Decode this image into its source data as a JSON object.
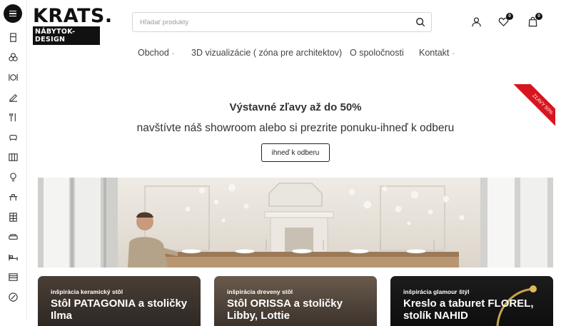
{
  "brand": {
    "name": "KRATS.",
    "tagline": "NÁBYTOK-DESIGN"
  },
  "search": {
    "placeholder": "Hľadať produkty",
    "value": ""
  },
  "header": {
    "wishlist_count": "0",
    "cart_count": "0"
  },
  "sidebar": {
    "icons": [
      "menu-icon",
      "wardrobe-icon",
      "shelving-icon",
      "dining-icon",
      "decor-icon",
      "cutlery-icon",
      "armchair-icon",
      "storage-icon",
      "lamp-icon",
      "table-icon",
      "cabinet-icon",
      "sofa-icon",
      "bed-icon",
      "dresser-icon",
      "sale-icon"
    ]
  },
  "nav": {
    "items": [
      {
        "label": "Obchod",
        "has_dropdown": true
      },
      {
        "label": "3D vizualizácie ( zóna pre architektov)",
        "has_dropdown": false
      },
      {
        "label": "O spoločnosti",
        "has_dropdown": false
      },
      {
        "label": "Kontakt",
        "has_dropdown": true
      }
    ],
    "chevron": "⌄"
  },
  "promo": {
    "title": "Výstavné zľavy až do 50%",
    "subtitle": "navštívte náš showroom alebo si prezrite ponuku-ihneď k odberu",
    "button": "ihneď k odberu",
    "ribbon": "ZĽAVY 50%",
    "ribbon_color": "#d7151e"
  },
  "cards": [
    {
      "tag": "inšpirácia keramický stôl",
      "title": "Stôl PATAGONIA a stoličky Ilma"
    },
    {
      "tag": "inšpirácia dreveny stôl",
      "title": "Stôl ORISSA a stoličky Libby, Lottie"
    },
    {
      "tag": "inšpirácia glamour štýl",
      "title": "Kreslo a taburet FLOREL, stolík NAHID"
    }
  ]
}
